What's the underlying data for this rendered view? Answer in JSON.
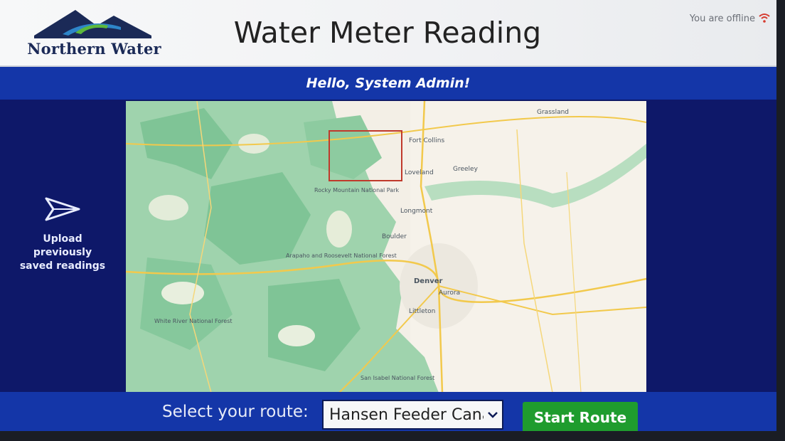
{
  "header": {
    "logo_text": "Northern Water",
    "title": "Water Meter Reading",
    "offline_text": "You are offline",
    "offline_icon": "wifi-off-icon"
  },
  "greeting": "Hello, System Admin!",
  "sidebar": {
    "upload_icon": "send-icon",
    "upload_label_lines": [
      "Upload",
      "previously",
      "saved readings"
    ]
  },
  "map": {
    "cities": [
      "Fort Collins",
      "Loveland",
      "Greeley",
      "Longmont",
      "Boulder",
      "Denver",
      "Aurora",
      "Littleton"
    ],
    "areas": [
      "Rocky Mountain National Park",
      "Arapaho and Roosevelt National Forest",
      "White River National Forest",
      "San Isabel National Forest",
      "Grassland"
    ]
  },
  "route": {
    "label": "Select your route:",
    "selected": "Hansen Feeder Canal"
  },
  "start_button": "Start Route",
  "colors": {
    "header_bg": "#f3f4f6",
    "greeting_bar": "#1436a8",
    "panel_bg": "#0e1869",
    "start_button": "#1f9c2e",
    "selection_box": "#c0392b"
  }
}
